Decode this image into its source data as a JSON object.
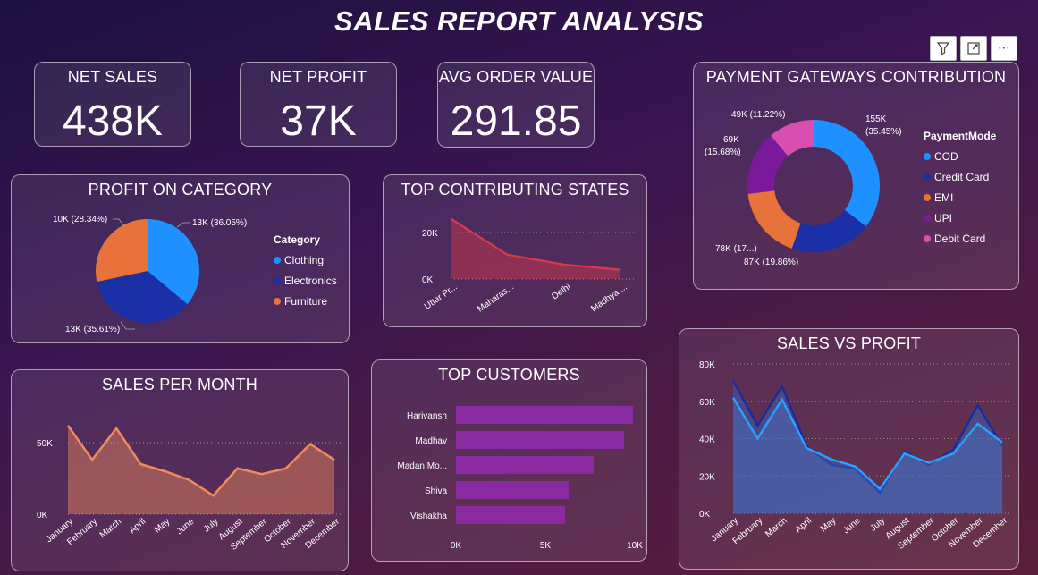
{
  "report": {
    "title": "SALES REPORT ANALYSIS"
  },
  "toolbar": {
    "filter_icon": "filter-icon",
    "focus_icon": "focus-mode-icon",
    "more_icon": "more-options-icon"
  },
  "kpis": {
    "net_sales": {
      "label": "NET SALES",
      "value": "438K"
    },
    "net_profit": {
      "label": "NET PROFIT",
      "value": "37K"
    },
    "avg_order": {
      "label": "AVG ORDER VALUE",
      "value": "291.85"
    }
  },
  "colors": {
    "blue": "#1e90ff",
    "navy": "#1b2fa6",
    "orange": "#e8733a",
    "purple": "#7a1a9a",
    "pink": "#d94fb0",
    "red": "#d93a4a",
    "bar": "#8a2aa0",
    "line_orange": "#f08a5d",
    "dark_blue": "#1a2a9a",
    "light_blue": "#2aa0ff"
  },
  "profit_category": {
    "title": "PROFIT ON CATEGORY",
    "legend_title": "Category",
    "chart_data": {
      "type": "pie",
      "categories": [
        "Clothing",
        "Electronics",
        "Furniture"
      ],
      "values": [
        36.05,
        35.61,
        28.34
      ],
      "labels": [
        "13K (36.05%)",
        "13K (35.61%)",
        "10K (28.34%)"
      ]
    }
  },
  "top_states": {
    "title": "TOP CONTRIBUTING STATES",
    "chart_data": {
      "type": "area",
      "categories": [
        "Uttar Pr...",
        "Maharas...",
        "Delhi",
        "Madhya ..."
      ],
      "values": [
        26000,
        10500,
        6200,
        4000
      ],
      "yticks": [
        "0K",
        "20K"
      ],
      "ylim": [
        0,
        30000
      ]
    }
  },
  "payment": {
    "title": "PAYMENT GATEWAYS CONTRIBUTION",
    "legend_title": "PaymentMode",
    "chart_data": {
      "type": "pie",
      "categories": [
        "COD",
        "Credit Card",
        "EMI",
        "UPI",
        "Debit Card"
      ],
      "values": [
        35.45,
        19.86,
        17.78,
        15.68,
        11.22
      ],
      "labels": [
        "155K\n(35.45%)",
        "87K (19.86%)",
        "78K (17...)",
        "69K\n(15.68%)",
        "49K (11.22%)"
      ]
    }
  },
  "sales_month": {
    "title": "SALES PER MONTH",
    "chart_data": {
      "type": "area",
      "categories": [
        "January",
        "February",
        "March",
        "April",
        "May",
        "June",
        "July",
        "August",
        "September",
        "October",
        "November",
        "December"
      ],
      "values": [
        62000,
        38000,
        60000,
        35000,
        30000,
        24000,
        13000,
        32000,
        28000,
        32000,
        49000,
        38000
      ],
      "yticks": [
        "0K",
        "50K"
      ],
      "ylim": [
        0,
        75000
      ]
    }
  },
  "top_customers": {
    "title": "TOP CUSTOMERS",
    "chart_data": {
      "type": "bar",
      "categories": [
        "Harivansh",
        "Madhav",
        "Madan Mo...",
        "Shiva",
        "Vishakha"
      ],
      "values": [
        9900,
        9400,
        7700,
        6300,
        6100
      ],
      "xticks": [
        "0K",
        "5K",
        "10K"
      ],
      "xlim": [
        0,
        10000
      ]
    }
  },
  "sales_profit": {
    "title": "SALES VS PROFIT",
    "chart_data": {
      "type": "area",
      "categories": [
        "January",
        "February",
        "March",
        "April",
        "May",
        "June",
        "July",
        "August",
        "September",
        "October",
        "November",
        "December"
      ],
      "series": [
        {
          "values": [
            71000,
            47000,
            68000,
            36000,
            26000,
            24000,
            11000,
            33000,
            26000,
            34000,
            58000,
            36000
          ]
        },
        {
          "values": [
            62000,
            40000,
            61000,
            35000,
            29000,
            25000,
            13000,
            32000,
            27000,
            32000,
            48000,
            38000
          ]
        }
      ],
      "yticks": [
        "0K",
        "20K",
        "40K",
        "60K",
        "80K"
      ],
      "ylim": [
        0,
        80000
      ]
    }
  }
}
